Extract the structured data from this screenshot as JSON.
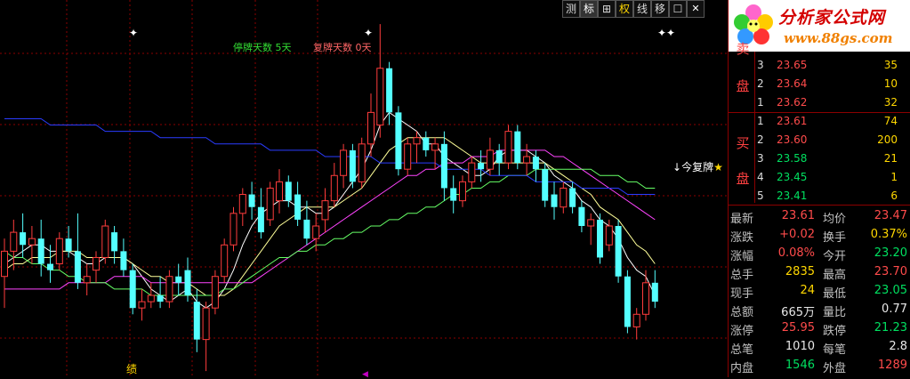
{
  "toolbar": [
    {
      "label": "测",
      "active": false
    },
    {
      "label": "标",
      "active": true
    },
    {
      "label": "⊞",
      "active": false
    },
    {
      "label": "权",
      "active": false
    },
    {
      "label": "线",
      "active": false
    },
    {
      "label": "移",
      "active": false
    },
    {
      "label": "☐",
      "active": false
    },
    {
      "label": "✕",
      "active": false
    }
  ],
  "legend": {
    "suspend_label": "停牌天数",
    "suspend_value": "5天",
    "resume_label": "复牌天数",
    "resume_value": "0天"
  },
  "markers": {
    "star1": "✦",
    "star2": "✦",
    "star3": "✦✦"
  },
  "resume_note": {
    "arrow": "↓",
    "text": "今复牌",
    "star": "★"
  },
  "bottom_label": "绩",
  "bottom_marker": "◀",
  "logo": {
    "brand": "分析家公式网",
    "url": "www.88gs.com"
  },
  "orderbook": {
    "sell_side_label_top": "卖",
    "sell_side_label": "盘",
    "buy_side_label_top": "买",
    "buy_side_label": "盘",
    "sell": [
      {
        "level": "3",
        "price": "23.65",
        "vol": "35"
      },
      {
        "level": "2",
        "price": "23.64",
        "vol": "10"
      },
      {
        "level": "1",
        "price": "23.62",
        "vol": "32"
      }
    ],
    "buy": [
      {
        "level": "1",
        "price": "23.61",
        "vol": "74"
      },
      {
        "level": "2",
        "price": "23.60",
        "vol": "200"
      },
      {
        "level": "3",
        "price": "23.58",
        "vol": "21"
      },
      {
        "level": "4",
        "price": "23.45",
        "vol": "1"
      },
      {
        "level": "5",
        "price": "23.41",
        "vol": "6"
      }
    ]
  },
  "stats": [
    {
      "l1": "最新",
      "v1": "23.61",
      "c1": "red",
      "l2": "均价",
      "v2": "23.47",
      "c2": "red"
    },
    {
      "l1": "涨跌",
      "v1": "+0.02",
      "c1": "red",
      "l2": "换手",
      "v2": "0.37%",
      "c2": "yellow"
    },
    {
      "l1": "涨幅",
      "v1": "0.08%",
      "c1": "red",
      "l2": "今开",
      "v2": "23.20",
      "c2": "green"
    },
    {
      "l1": "总手",
      "v1": "2835",
      "c1": "yellow",
      "l2": "最高",
      "v2": "23.70",
      "c2": "red"
    },
    {
      "l1": "现手",
      "v1": "24",
      "c1": "yellow",
      "l2": "最低",
      "v2": "23.05",
      "c2": "green"
    },
    {
      "l1": "总额",
      "v1": "665万",
      "c1": "white",
      "l2": "量比",
      "v2": "0.77",
      "c2": "white"
    },
    {
      "l1": "涨停",
      "v1": "25.95",
      "c1": "red",
      "l2": "跌停",
      "v2": "21.23",
      "c2": "green"
    },
    {
      "l1": "总笔",
      "v1": "1010",
      "c1": "white",
      "l2": "每笔",
      "v2": "2.8",
      "c2": "white"
    },
    {
      "l1": "内盘",
      "v1": "1546",
      "c1": "green",
      "l2": "外盘",
      "v2": "1289",
      "c2": "red"
    }
  ],
  "colors": {
    "up": "#ff3c3c",
    "down": "#54ffff",
    "grid": "#8b0000",
    "ma5": "#ffffff",
    "ma10": "#ffff99",
    "ma20": "#ff44ff",
    "ma60": "#66ff66",
    "ma120": "#2a3cff"
  },
  "chart_data": {
    "type": "candlestick",
    "price_range": [
      21.0,
      26.5
    ],
    "candles": [
      {
        "o": 22.4,
        "h": 23.0,
        "l": 21.9,
        "c": 22.8
      },
      {
        "o": 22.8,
        "h": 23.3,
        "l": 22.5,
        "c": 23.1
      },
      {
        "o": 23.1,
        "h": 23.4,
        "l": 22.7,
        "c": 22.9
      },
      {
        "o": 22.9,
        "h": 23.2,
        "l": 22.6,
        "c": 23.0
      },
      {
        "o": 23.0,
        "h": 23.3,
        "l": 22.4,
        "c": 22.6
      },
      {
        "o": 22.6,
        "h": 22.9,
        "l": 22.3,
        "c": 22.5
      },
      {
        "o": 22.6,
        "h": 23.1,
        "l": 22.5,
        "c": 23.0
      },
      {
        "o": 23.0,
        "h": 23.2,
        "l": 22.7,
        "c": 22.8
      },
      {
        "o": 22.8,
        "h": 23.4,
        "l": 22.2,
        "c": 22.3
      },
      {
        "o": 22.3,
        "h": 22.6,
        "l": 22.1,
        "c": 22.4
      },
      {
        "o": 22.5,
        "h": 22.8,
        "l": 22.3,
        "c": 22.7
      },
      {
        "o": 22.7,
        "h": 23.3,
        "l": 22.6,
        "c": 23.2
      },
      {
        "o": 23.1,
        "h": 23.2,
        "l": 22.6,
        "c": 22.8
      },
      {
        "o": 22.8,
        "h": 23.0,
        "l": 22.4,
        "c": 22.5
      },
      {
        "o": 22.5,
        "h": 22.6,
        "l": 21.8,
        "c": 21.9
      },
      {
        "o": 21.9,
        "h": 22.2,
        "l": 21.7,
        "c": 22.0
      },
      {
        "o": 22.0,
        "h": 22.3,
        "l": 21.9,
        "c": 22.1
      },
      {
        "o": 22.1,
        "h": 22.4,
        "l": 21.9,
        "c": 22.0
      },
      {
        "o": 22.0,
        "h": 22.5,
        "l": 21.9,
        "c": 22.4
      },
      {
        "o": 22.4,
        "h": 22.6,
        "l": 22.1,
        "c": 22.3
      },
      {
        "o": 22.5,
        "h": 22.7,
        "l": 22.0,
        "c": 22.1
      },
      {
        "o": 22.0,
        "h": 22.2,
        "l": 21.2,
        "c": 21.4
      },
      {
        "o": 21.4,
        "h": 22.0,
        "l": 20.9,
        "c": 21.9
      },
      {
        "o": 21.9,
        "h": 22.5,
        "l": 21.8,
        "c": 22.4
      },
      {
        "o": 22.4,
        "h": 23.0,
        "l": 22.3,
        "c": 22.9
      },
      {
        "o": 22.9,
        "h": 23.5,
        "l": 22.8,
        "c": 23.4
      },
      {
        "o": 23.4,
        "h": 23.8,
        "l": 23.2,
        "c": 23.7
      },
      {
        "o": 23.7,
        "h": 23.9,
        "l": 23.3,
        "c": 23.5
      },
      {
        "o": 23.5,
        "h": 23.8,
        "l": 23.0,
        "c": 23.1
      },
      {
        "o": 23.3,
        "h": 23.9,
        "l": 23.2,
        "c": 23.8
      },
      {
        "o": 23.6,
        "h": 24.1,
        "l": 23.4,
        "c": 23.9
      },
      {
        "o": 23.9,
        "h": 24.0,
        "l": 23.5,
        "c": 23.6
      },
      {
        "o": 23.7,
        "h": 23.9,
        "l": 23.2,
        "c": 23.3
      },
      {
        "o": 23.3,
        "h": 23.6,
        "l": 22.9,
        "c": 23.0
      },
      {
        "o": 23.0,
        "h": 23.4,
        "l": 22.8,
        "c": 23.2
      },
      {
        "o": 23.3,
        "h": 23.8,
        "l": 23.1,
        "c": 23.6
      },
      {
        "o": 23.6,
        "h": 24.2,
        "l": 23.5,
        "c": 24.0
      },
      {
        "o": 24.0,
        "h": 24.5,
        "l": 23.8,
        "c": 24.4
      },
      {
        "o": 24.4,
        "h": 24.5,
        "l": 23.8,
        "c": 23.9
      },
      {
        "o": 23.9,
        "h": 24.6,
        "l": 23.8,
        "c": 24.5
      },
      {
        "o": 24.5,
        "h": 25.3,
        "l": 24.3,
        "c": 25.0
      },
      {
        "o": 24.8,
        "h": 26.4,
        "l": 24.6,
        "c": 25.7
      },
      {
        "o": 25.7,
        "h": 25.8,
        "l": 24.8,
        "c": 25.0
      },
      {
        "o": 25.0,
        "h": 25.1,
        "l": 24.0,
        "c": 24.1
      },
      {
        "o": 24.1,
        "h": 24.6,
        "l": 24.0,
        "c": 24.5
      },
      {
        "o": 24.5,
        "h": 24.7,
        "l": 24.2,
        "c": 24.6
      },
      {
        "o": 24.6,
        "h": 24.7,
        "l": 24.3,
        "c": 24.4
      },
      {
        "o": 24.4,
        "h": 24.6,
        "l": 24.1,
        "c": 24.5
      },
      {
        "o": 24.5,
        "h": 24.7,
        "l": 23.6,
        "c": 23.8
      },
      {
        "o": 23.8,
        "h": 24.0,
        "l": 23.4,
        "c": 23.6
      },
      {
        "o": 23.6,
        "h": 24.0,
        "l": 23.5,
        "c": 23.9
      },
      {
        "o": 23.9,
        "h": 24.3,
        "l": 23.8,
        "c": 24.2
      },
      {
        "o": 24.2,
        "h": 24.4,
        "l": 23.9,
        "c": 24.1
      },
      {
        "o": 24.1,
        "h": 24.6,
        "l": 24.0,
        "c": 24.4
      },
      {
        "o": 24.4,
        "h": 24.5,
        "l": 24.0,
        "c": 24.2
      },
      {
        "o": 24.2,
        "h": 24.8,
        "l": 24.1,
        "c": 24.7
      },
      {
        "o": 24.7,
        "h": 24.8,
        "l": 24.1,
        "c": 24.2
      },
      {
        "o": 24.2,
        "h": 24.5,
        "l": 24.0,
        "c": 24.3
      },
      {
        "o": 24.3,
        "h": 24.4,
        "l": 23.9,
        "c": 24.1
      },
      {
        "o": 24.1,
        "h": 24.2,
        "l": 23.5,
        "c": 23.6
      },
      {
        "o": 23.7,
        "h": 23.9,
        "l": 23.3,
        "c": 23.5
      },
      {
        "o": 23.5,
        "h": 23.9,
        "l": 23.4,
        "c": 23.8
      },
      {
        "o": 23.8,
        "h": 23.9,
        "l": 23.4,
        "c": 23.5
      },
      {
        "o": 23.5,
        "h": 23.6,
        "l": 23.1,
        "c": 23.2
      },
      {
        "o": 23.2,
        "h": 23.4,
        "l": 22.9,
        "c": 23.3
      },
      {
        "o": 23.3,
        "h": 23.4,
        "l": 22.6,
        "c": 22.7
      },
      {
        "o": 22.9,
        "h": 23.3,
        "l": 22.8,
        "c": 23.2
      },
      {
        "o": 23.2,
        "h": 23.3,
        "l": 22.3,
        "c": 22.4
      },
      {
        "o": 22.4,
        "h": 22.5,
        "l": 21.5,
        "c": 21.6
      },
      {
        "o": 21.6,
        "h": 21.9,
        "l": 21.4,
        "c": 21.8
      },
      {
        "o": 21.8,
        "h": 22.5,
        "l": 21.7,
        "c": 22.3
      },
      {
        "o": 22.3,
        "h": 22.5,
        "l": 21.9,
        "c": 22.0
      }
    ],
    "ma_lines": [
      {
        "name": "MA5",
        "color": "#ffffff",
        "values": [
          22.6,
          22.7,
          22.8,
          22.9,
          22.9,
          22.8,
          22.8,
          22.8,
          22.7,
          22.6,
          22.6,
          22.7,
          22.7,
          22.7,
          22.6,
          22.4,
          22.2,
          22.1,
          22.0,
          22.1,
          22.2,
          22.0,
          21.9,
          22.0,
          22.2,
          22.5,
          22.9,
          23.2,
          23.4,
          23.5,
          23.6,
          23.6,
          23.5,
          23.5,
          23.4,
          23.4,
          23.5,
          23.7,
          23.9,
          24.1,
          24.4,
          24.8,
          25.0,
          24.9,
          24.8,
          24.7,
          24.5,
          24.5,
          24.3,
          24.2,
          24.1,
          24.0,
          24.0,
          24.1,
          24.3,
          24.4,
          24.4,
          24.4,
          24.3,
          24.2,
          24.0,
          23.9,
          23.8,
          23.6,
          23.5,
          23.3,
          23.2,
          23.0,
          22.7,
          22.5,
          22.4,
          22.1
        ]
      },
      {
        "name": "MA10",
        "color": "#ffff99",
        "values": [
          22.5,
          22.6,
          22.6,
          22.7,
          22.7,
          22.7,
          22.8,
          22.8,
          22.8,
          22.7,
          22.7,
          22.7,
          22.7,
          22.7,
          22.6,
          22.5,
          22.4,
          22.4,
          22.3,
          22.3,
          22.3,
          22.2,
          22.1,
          22.1,
          22.1,
          22.2,
          22.4,
          22.6,
          22.8,
          23.0,
          23.2,
          23.3,
          23.4,
          23.5,
          23.5,
          23.5,
          23.5,
          23.6,
          23.7,
          23.8,
          24.0,
          24.2,
          24.4,
          24.5,
          24.6,
          24.6,
          24.6,
          24.6,
          24.6,
          24.5,
          24.4,
          24.3,
          24.2,
          24.2,
          24.2,
          24.2,
          24.2,
          24.2,
          24.2,
          24.2,
          24.1,
          24.0,
          23.9,
          23.8,
          23.7,
          23.5,
          23.4,
          23.3,
          23.1,
          22.9,
          22.8,
          22.6
        ]
      },
      {
        "name": "MA20",
        "color": "#ff44ff",
        "values": [
          22.2,
          22.2,
          22.2,
          22.2,
          22.2,
          22.2,
          22.2,
          22.3,
          22.3,
          22.3,
          22.3,
          22.3,
          22.4,
          22.4,
          22.4,
          22.4,
          22.3,
          22.3,
          22.3,
          22.3,
          22.3,
          22.3,
          22.3,
          22.3,
          22.3,
          22.3,
          22.3,
          22.3,
          22.4,
          22.5,
          22.6,
          22.7,
          22.8,
          22.9,
          23.0,
          23.1,
          23.2,
          23.3,
          23.4,
          23.5,
          23.6,
          23.7,
          23.8,
          23.9,
          24.0,
          24.0,
          24.1,
          24.1,
          24.2,
          24.2,
          24.2,
          24.3,
          24.3,
          24.3,
          24.4,
          24.4,
          24.4,
          24.4,
          24.4,
          24.4,
          24.3,
          24.3,
          24.2,
          24.1,
          24.0,
          23.9,
          23.8,
          23.7,
          23.6,
          23.5,
          23.4,
          23.3
        ]
      },
      {
        "name": "MA60",
        "color": "#66ff66",
        "values": [
          22.8,
          22.7,
          22.7,
          22.6,
          22.6,
          22.5,
          22.5,
          22.4,
          22.4,
          22.3,
          22.3,
          22.3,
          22.2,
          22.2,
          22.2,
          22.2,
          22.1,
          22.1,
          22.1,
          22.1,
          22.1,
          22.1,
          22.1,
          22.1,
          22.2,
          22.2,
          22.3,
          22.4,
          22.5,
          22.6,
          22.7,
          22.7,
          22.8,
          22.8,
          22.9,
          22.9,
          23.0,
          23.0,
          23.1,
          23.1,
          23.2,
          23.2,
          23.3,
          23.3,
          23.4,
          23.4,
          23.5,
          23.5,
          23.6,
          23.7,
          23.7,
          23.8,
          23.8,
          23.9,
          23.9,
          24.0,
          24.0,
          24.0,
          24.1,
          24.1,
          24.1,
          24.1,
          24.1,
          24.1,
          24.1,
          24.0,
          24.0,
          24.0,
          23.9,
          23.9,
          23.8,
          23.8
        ]
      },
      {
        "name": "MA120",
        "color": "#2a3cff",
        "values": [
          24.9,
          24.9,
          24.9,
          24.9,
          24.9,
          24.8,
          24.8,
          24.8,
          24.8,
          24.8,
          24.8,
          24.7,
          24.7,
          24.7,
          24.7,
          24.7,
          24.7,
          24.6,
          24.6,
          24.6,
          24.6,
          24.6,
          24.6,
          24.5,
          24.5,
          24.5,
          24.5,
          24.5,
          24.5,
          24.4,
          24.4,
          24.4,
          24.4,
          24.4,
          24.4,
          24.3,
          24.3,
          24.3,
          24.3,
          24.3,
          24.3,
          24.2,
          24.2,
          24.2,
          24.2,
          24.2,
          24.2,
          24.2,
          24.1,
          24.1,
          24.1,
          24.1,
          24.1,
          24.0,
          24.0,
          24.0,
          24.0,
          24.0,
          23.9,
          23.9,
          23.9,
          23.9,
          23.9,
          23.8,
          23.8,
          23.8,
          23.8,
          23.8,
          23.7,
          23.7,
          23.7,
          23.7
        ]
      }
    ]
  }
}
